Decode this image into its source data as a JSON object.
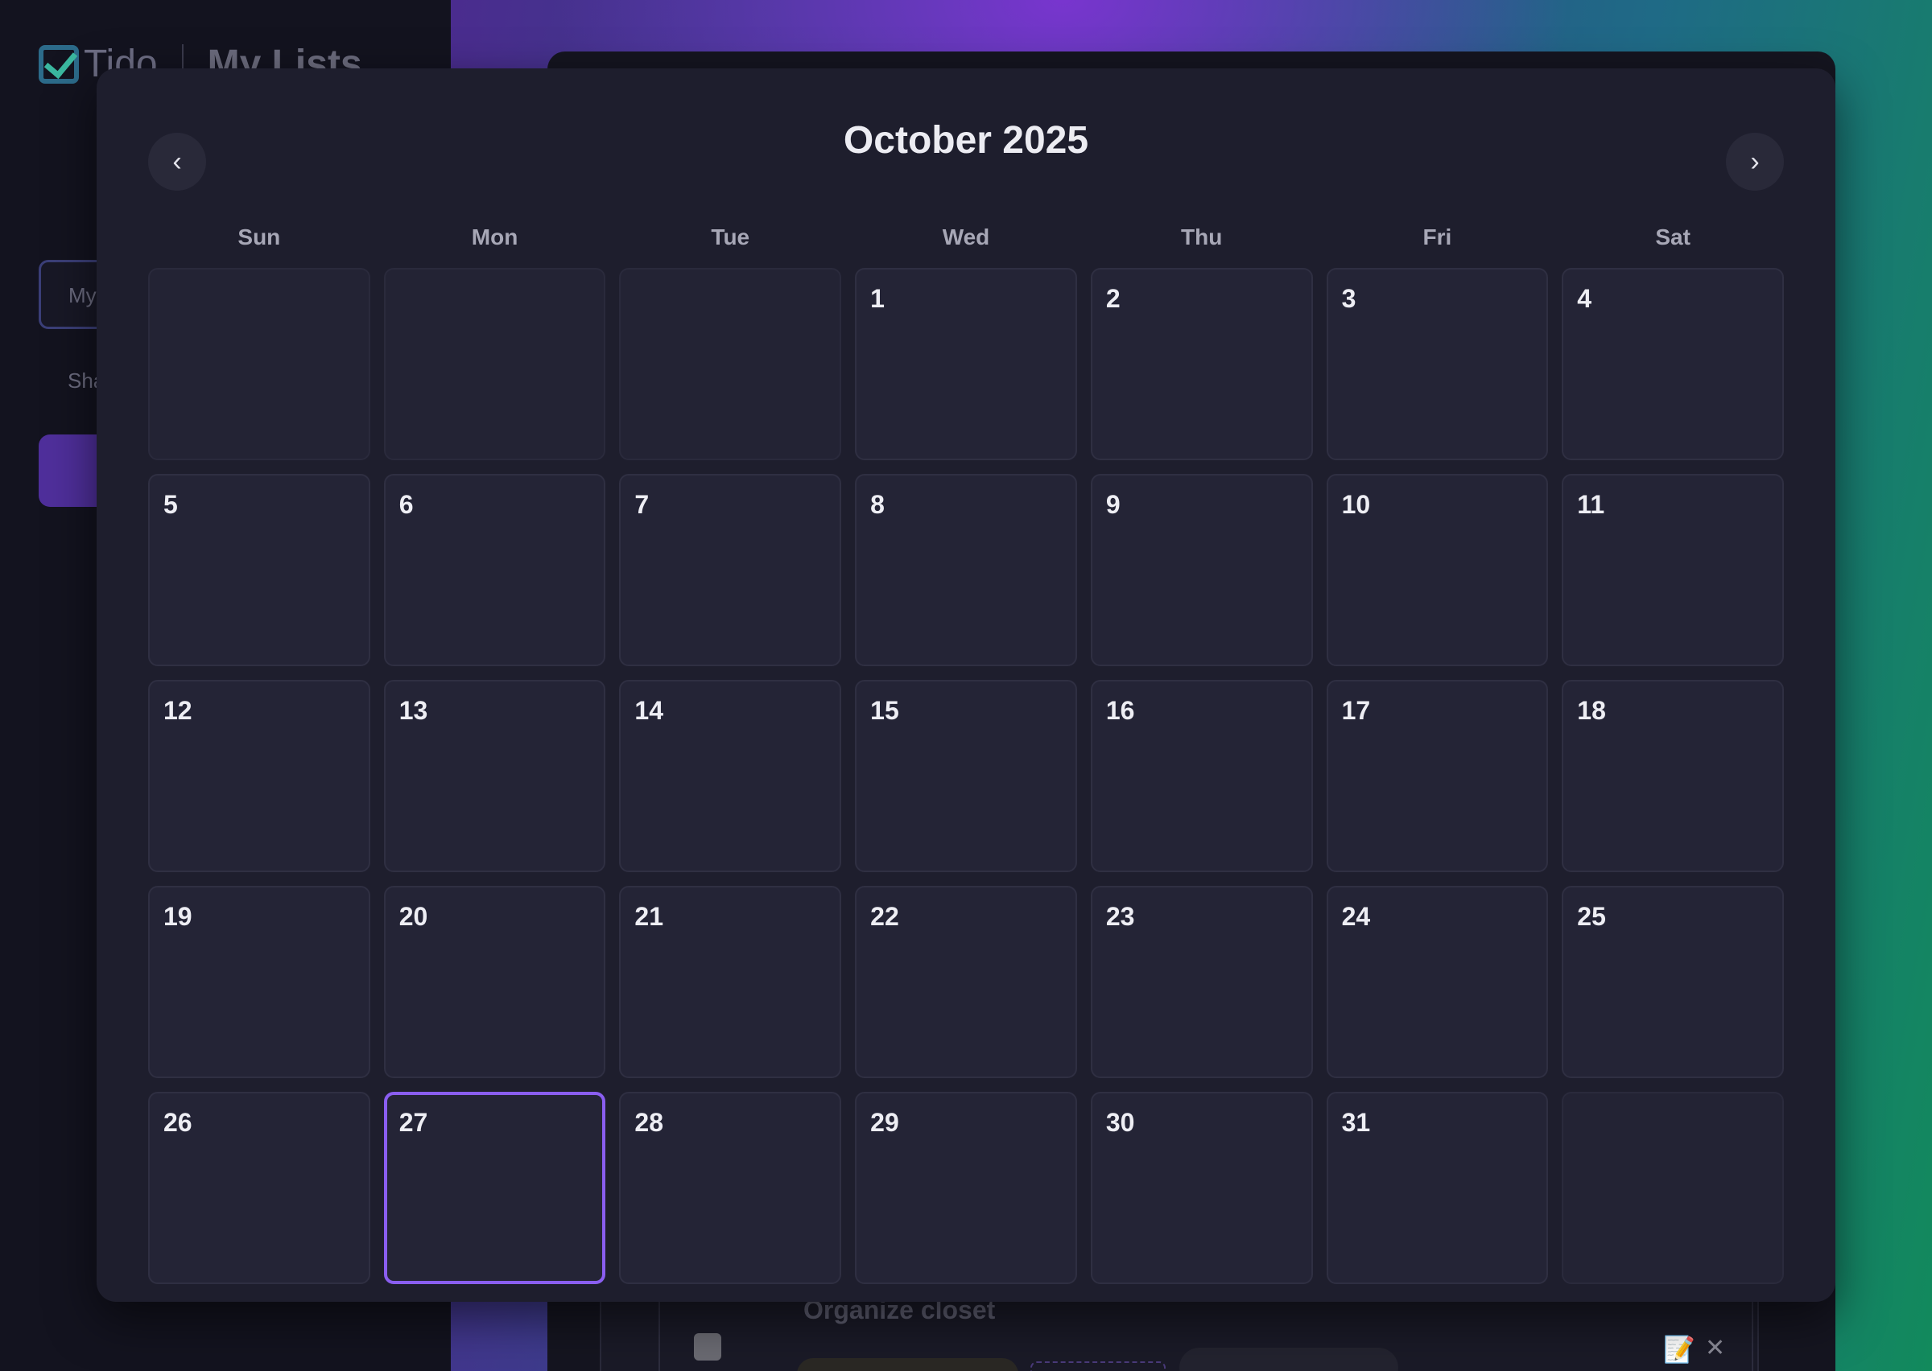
{
  "background": {
    "brand_name": "Tido",
    "page_title": "My Lists",
    "sidebar_input_value": "My",
    "sidebar_shared_label": "Sha",
    "task_title": "Organize closet",
    "edit_icon": "📝",
    "close_icon": "✕"
  },
  "calendar": {
    "month_title": "October 2025",
    "prev_icon": "‹",
    "next_icon": "›",
    "weekdays": [
      "Sun",
      "Mon",
      "Tue",
      "Wed",
      "Thu",
      "Fri",
      "Sat"
    ],
    "leading_empty_days": 3,
    "days_in_month": 31,
    "selected_day": 27,
    "accent_color": "#8a5ef0"
  }
}
